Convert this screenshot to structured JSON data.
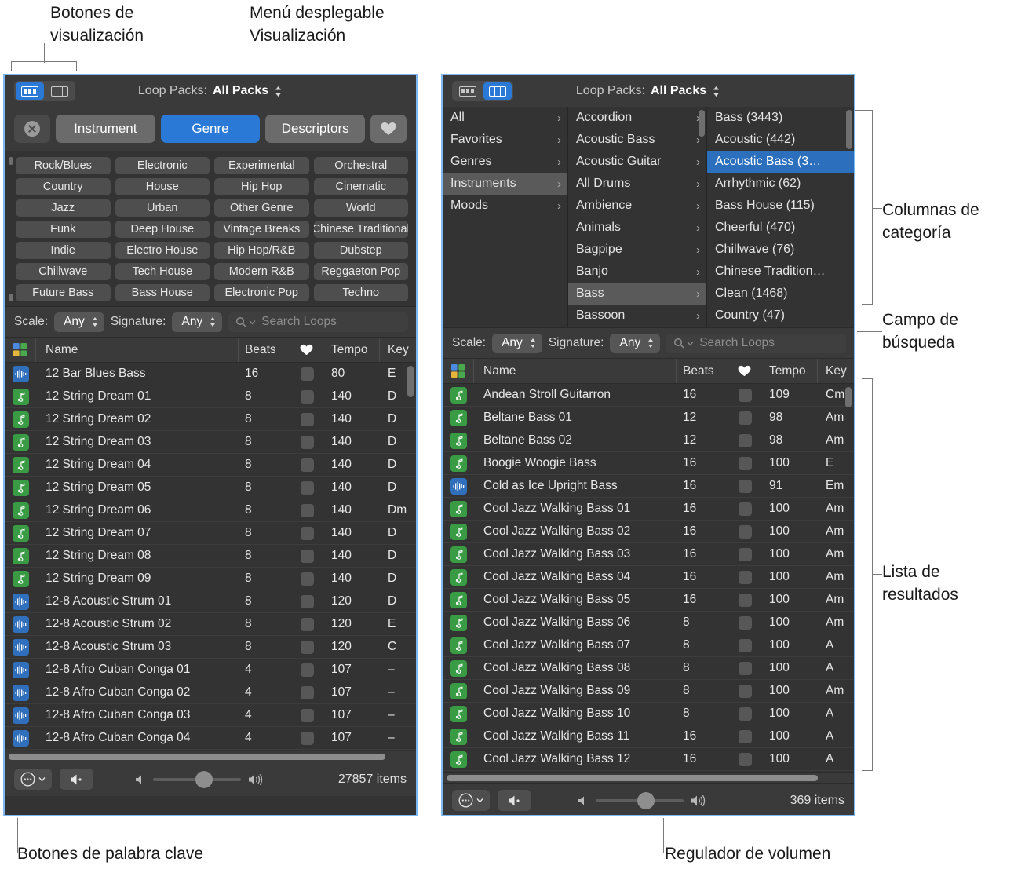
{
  "annotations": {
    "view_buttons": "Botones de\nvisualización",
    "view_menu": "Menú desplegable\nVisualización",
    "category_columns": "Columnas de\ncategoría",
    "search_field": "Campo de\nbúsqueda",
    "results_list": "Lista de\nresultados",
    "keyword_buttons": "Botones de palabra clave",
    "volume_slider": "Regulador de volumen"
  },
  "colors": {
    "accent_blue": "#2b79d6",
    "selection_blue": "#2b6fbd",
    "window_border": "#7eb8f2",
    "panel_bg": "#333333",
    "toolbar_bg": "#3a3a3a",
    "midi_icon_green": "#3a9b45",
    "audio_icon_blue": "#2f6fbb"
  },
  "left_window": {
    "toolbar": {
      "button_view_icon": "grid-view-icon",
      "column_view_icon": "column-view-icon",
      "active_view": "button-view",
      "loop_packs_label": "Loop Packs:",
      "loop_packs_value": "All Packs"
    },
    "keyword_bar": {
      "reset_icon": "circle-x-icon",
      "buttons": [
        "Instrument",
        "Genre",
        "Descriptors"
      ],
      "selected": "Genre",
      "favorites_icon": "heart-icon"
    },
    "genre_grid": [
      "Rock/Blues",
      "Electronic",
      "Experimental",
      "Orchestral",
      "Country",
      "House",
      "Hip Hop",
      "Cinematic",
      "Jazz",
      "Urban",
      "Other Genre",
      "World",
      "Funk",
      "Deep House",
      "Vintage Breaks",
      "Chinese Traditional",
      "Indie",
      "Electro House",
      "Hip Hop/R&B",
      "Dubstep",
      "Chillwave",
      "Tech House",
      "Modern R&B",
      "Reggaeton Pop",
      "Future Bass",
      "Bass House",
      "Electronic Pop",
      "Techno"
    ],
    "filter_bar": {
      "scale_label": "Scale:",
      "scale_value": "Any",
      "signature_label": "Signature:",
      "signature_value": "Any",
      "search_placeholder": "Search Loops",
      "search_value": ""
    },
    "table": {
      "columns": [
        "Name",
        "Beats",
        "Tempo",
        "Key"
      ],
      "fav_column_icon": "heart-icon",
      "type_column_icon": "color-grid-icon",
      "rows": [
        {
          "icon": "audio",
          "name": "12 Bar Blues Bass",
          "beats": "16",
          "tempo": "80",
          "key": "E"
        },
        {
          "icon": "midi",
          "name": "12 String Dream 01",
          "beats": "8",
          "tempo": "140",
          "key": "D"
        },
        {
          "icon": "midi",
          "name": "12 String Dream 02",
          "beats": "8",
          "tempo": "140",
          "key": "D"
        },
        {
          "icon": "midi",
          "name": "12 String Dream 03",
          "beats": "8",
          "tempo": "140",
          "key": "D"
        },
        {
          "icon": "midi",
          "name": "12 String Dream 04",
          "beats": "8",
          "tempo": "140",
          "key": "D"
        },
        {
          "icon": "midi",
          "name": "12 String Dream 05",
          "beats": "8",
          "tempo": "140",
          "key": "D"
        },
        {
          "icon": "midi",
          "name": "12 String Dream 06",
          "beats": "8",
          "tempo": "140",
          "key": "Dm"
        },
        {
          "icon": "midi",
          "name": "12 String Dream 07",
          "beats": "8",
          "tempo": "140",
          "key": "D"
        },
        {
          "icon": "midi",
          "name": "12 String Dream 08",
          "beats": "8",
          "tempo": "140",
          "key": "D"
        },
        {
          "icon": "midi",
          "name": "12 String Dream 09",
          "beats": "8",
          "tempo": "140",
          "key": "D"
        },
        {
          "icon": "audio",
          "name": "12-8 Acoustic Strum 01",
          "beats": "8",
          "tempo": "120",
          "key": "D"
        },
        {
          "icon": "audio",
          "name": "12-8 Acoustic Strum 02",
          "beats": "8",
          "tempo": "120",
          "key": "E"
        },
        {
          "icon": "audio",
          "name": "12-8 Acoustic Strum 03",
          "beats": "8",
          "tempo": "120",
          "key": "C"
        },
        {
          "icon": "audio",
          "name": "12-8 Afro Cuban Conga 01",
          "beats": "4",
          "tempo": "107",
          "key": "–"
        },
        {
          "icon": "audio",
          "name": "12-8 Afro Cuban Conga 02",
          "beats": "4",
          "tempo": "107",
          "key": "–"
        },
        {
          "icon": "audio",
          "name": "12-8 Afro Cuban Conga 03",
          "beats": "4",
          "tempo": "107",
          "key": "–"
        },
        {
          "icon": "audio",
          "name": "12-8 Afro Cuban Conga 04",
          "beats": "4",
          "tempo": "107",
          "key": "–"
        }
      ]
    },
    "bottom_bar": {
      "action_menu_icon": "ellipsis-circle-icon",
      "mute_icon": "speaker-mute-icon",
      "volume_low_icon": "speaker-low-icon",
      "volume_high_icon": "speaker-high-icon",
      "volume_percent": 58,
      "items_count": "27857 items"
    }
  },
  "right_window": {
    "toolbar": {
      "button_view_icon": "grid-view-icon",
      "column_view_icon": "column-view-icon",
      "active_view": "column-view",
      "loop_packs_label": "Loop Packs:",
      "loop_packs_value": "All Packs"
    },
    "column_browser": {
      "column1": {
        "items": [
          "All",
          "Favorites",
          "Genres",
          "Instruments",
          "Moods"
        ],
        "selected": "Instruments"
      },
      "column2": {
        "items": [
          "Accordion",
          "Acoustic Bass",
          "Acoustic Guitar",
          "All Drums",
          "Ambience",
          "Animals",
          "Bagpipe",
          "Banjo",
          "Bass",
          "Bassoon"
        ],
        "selected": "Bass"
      },
      "column3": {
        "items": [
          "Bass (3443)",
          "Acoustic (442)",
          "Acoustic Bass (3…",
          "Arrhythmic (62)",
          "Bass House (115)",
          "Cheerful (470)",
          "Chillwave (76)",
          "Chinese Tradition…",
          "Clean (1468)",
          "Country (47)"
        ],
        "selected": "Acoustic Bass (3…"
      }
    },
    "filter_bar": {
      "scale_label": "Scale:",
      "scale_value": "Any",
      "signature_label": "Signature:",
      "signature_value": "Any",
      "search_placeholder": "Search Loops",
      "search_value": ""
    },
    "table": {
      "columns": [
        "Name",
        "Beats",
        "Tempo",
        "Key"
      ],
      "fav_column_icon": "heart-icon",
      "type_column_icon": "color-grid-icon",
      "rows": [
        {
          "icon": "midi",
          "name": "Andean Stroll Guitarron",
          "beats": "16",
          "tempo": "109",
          "key": "Cm"
        },
        {
          "icon": "midi",
          "name": "Beltane Bass 01",
          "beats": "12",
          "tempo": "98",
          "key": "Am"
        },
        {
          "icon": "midi",
          "name": "Beltane Bass 02",
          "beats": "12",
          "tempo": "98",
          "key": "Am"
        },
        {
          "icon": "midi",
          "name": "Boogie Woogie Bass",
          "beats": "16",
          "tempo": "100",
          "key": "E"
        },
        {
          "icon": "audio",
          "name": "Cold as Ice Upright Bass",
          "beats": "16",
          "tempo": "91",
          "key": "Em"
        },
        {
          "icon": "midi",
          "name": "Cool Jazz Walking Bass 01",
          "beats": "16",
          "tempo": "100",
          "key": "Am"
        },
        {
          "icon": "midi",
          "name": "Cool Jazz Walking Bass 02",
          "beats": "16",
          "tempo": "100",
          "key": "Am"
        },
        {
          "icon": "midi",
          "name": "Cool Jazz Walking Bass 03",
          "beats": "16",
          "tempo": "100",
          "key": "Am"
        },
        {
          "icon": "midi",
          "name": "Cool Jazz Walking Bass 04",
          "beats": "16",
          "tempo": "100",
          "key": "Am"
        },
        {
          "icon": "midi",
          "name": "Cool Jazz Walking Bass 05",
          "beats": "16",
          "tempo": "100",
          "key": "Am"
        },
        {
          "icon": "midi",
          "name": "Cool Jazz Walking Bass 06",
          "beats": "8",
          "tempo": "100",
          "key": "Am"
        },
        {
          "icon": "midi",
          "name": "Cool Jazz Walking Bass 07",
          "beats": "8",
          "tempo": "100",
          "key": "A"
        },
        {
          "icon": "midi",
          "name": "Cool Jazz Walking Bass 08",
          "beats": "8",
          "tempo": "100",
          "key": "A"
        },
        {
          "icon": "midi",
          "name": "Cool Jazz Walking Bass 09",
          "beats": "8",
          "tempo": "100",
          "key": "Am"
        },
        {
          "icon": "midi",
          "name": "Cool Jazz Walking Bass 10",
          "beats": "8",
          "tempo": "100",
          "key": "A"
        },
        {
          "icon": "midi",
          "name": "Cool Jazz Walking Bass 11",
          "beats": "16",
          "tempo": "100",
          "key": "A"
        },
        {
          "icon": "midi",
          "name": "Cool Jazz Walking Bass 12",
          "beats": "16",
          "tempo": "100",
          "key": "A"
        }
      ]
    },
    "bottom_bar": {
      "action_menu_icon": "ellipsis-circle-icon",
      "mute_icon": "speaker-mute-icon",
      "volume_low_icon": "speaker-low-icon",
      "volume_high_icon": "speaker-high-icon",
      "volume_percent": 58,
      "items_count": "369 items"
    }
  }
}
